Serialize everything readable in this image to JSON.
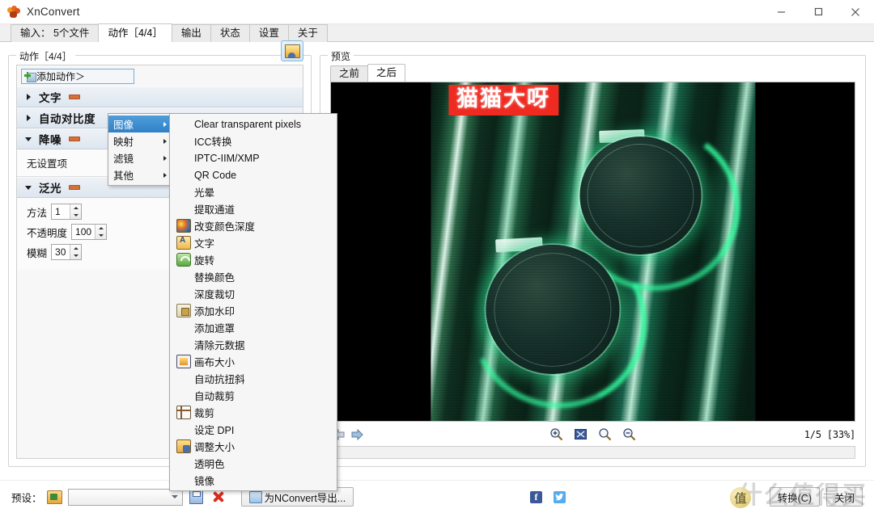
{
  "window": {
    "title": "XnConvert",
    "app_icon": "flower-icon",
    "minimize_label": "–",
    "maximize_label": "□",
    "close_label": "✕"
  },
  "tabs": [
    {
      "label": "输入： 5个文件",
      "name": "tab-input",
      "active": false
    },
    {
      "label": "动作［4/4］",
      "name": "tab-actions",
      "active": true
    },
    {
      "label": "输出",
      "name": "tab-output",
      "active": false
    },
    {
      "label": "状态",
      "name": "tab-status",
      "active": false
    },
    {
      "label": "设置",
      "name": "tab-settings",
      "active": false
    },
    {
      "label": "关于",
      "name": "tab-about",
      "active": false
    }
  ],
  "actions_panel": {
    "legend": "动作［4/4］",
    "add_action_label": "添加动作＞",
    "preview_toggle_icon": "image-preview-icon",
    "items": [
      {
        "label": "文字",
        "expanded": false,
        "body": null
      },
      {
        "label": "自动对比度",
        "expanded": false,
        "body": null
      },
      {
        "label": "降噪",
        "expanded": true,
        "body": "无设置项"
      },
      {
        "label": "泛光",
        "expanded": true,
        "body": null
      }
    ],
    "glow_params": [
      {
        "label": "方法",
        "value": "1"
      },
      {
        "label": "不透明度",
        "value": "100"
      },
      {
        "label": "模糊",
        "value": "30"
      }
    ]
  },
  "menu_root": {
    "items": [
      {
        "label": "图像",
        "selected": true,
        "has_submenu": true
      },
      {
        "label": "映射",
        "selected": false,
        "has_submenu": true
      },
      {
        "label": "滤镜",
        "selected": false,
        "has_submenu": true
      },
      {
        "label": "其他",
        "selected": false,
        "has_submenu": true
      }
    ]
  },
  "menu_image": {
    "items": [
      {
        "label": "Clear transparent pixels",
        "icon": null
      },
      {
        "label": "ICC转换",
        "icon": null
      },
      {
        "label": "IPTC-IIM/XMP",
        "icon": null
      },
      {
        "label": "QR Code",
        "icon": null
      },
      {
        "label": "光晕",
        "icon": null
      },
      {
        "label": "提取通道",
        "icon": null
      },
      {
        "label": "改变颜色深度",
        "icon": "color-depth-icon"
      },
      {
        "label": "文字",
        "icon": "text-icon"
      },
      {
        "label": "旋转",
        "icon": "rotate-icon"
      },
      {
        "label": "替换颜色",
        "icon": null
      },
      {
        "label": "深度裁切",
        "icon": null
      },
      {
        "label": "添加水印",
        "icon": "watermark-icon"
      },
      {
        "label": "添加遮罩",
        "icon": null
      },
      {
        "label": "清除元数据",
        "icon": null
      },
      {
        "label": "画布大小",
        "icon": "canvas-size-icon"
      },
      {
        "label": "自动抗扭斜",
        "icon": null
      },
      {
        "label": "自动裁剪",
        "icon": null
      },
      {
        "label": "裁剪",
        "icon": "crop-icon"
      },
      {
        "label": "设定 DPI",
        "icon": null
      },
      {
        "label": "调整大小",
        "icon": "resize-icon"
      },
      {
        "label": "透明色",
        "icon": null
      },
      {
        "label": "镜像",
        "icon": null
      }
    ]
  },
  "preview": {
    "legend": "预览",
    "tabs": [
      {
        "label": "之前",
        "active": false
      },
      {
        "label": "之后",
        "active": true
      }
    ],
    "image": {
      "banner_text": "猫猫大呀",
      "banner_color": "#ef2a20",
      "description": "green-glowing-wireless-earbuds-photo"
    },
    "toolbar": {
      "prev_icon": "arrow-left-icon",
      "next_icon": "arrow-right-icon",
      "zoom_in_icon": "zoom-in-icon",
      "fit_icon": "fit-to-window-icon",
      "zoom_actual_icon": "zoom-normal-icon",
      "zoom_out_icon": "zoom-out-icon",
      "page_indicator": "1/5 [33%]"
    }
  },
  "bottom": {
    "preset_label": "预设：",
    "folder_icon": "folder-open-icon",
    "preset_value": "",
    "preset_placeholder": "",
    "save_icon": "save-icon",
    "delete_icon": "delete-x-icon",
    "export_button": "为NConvert导出...",
    "export_icon": "export-icon",
    "facebook_icon": "facebook-icon",
    "twitter_icon": "twitter-icon",
    "convert_button": "转换(C)",
    "close_button": "关闭",
    "watermark_text": "什么值得买",
    "watermark_badge": "值"
  }
}
